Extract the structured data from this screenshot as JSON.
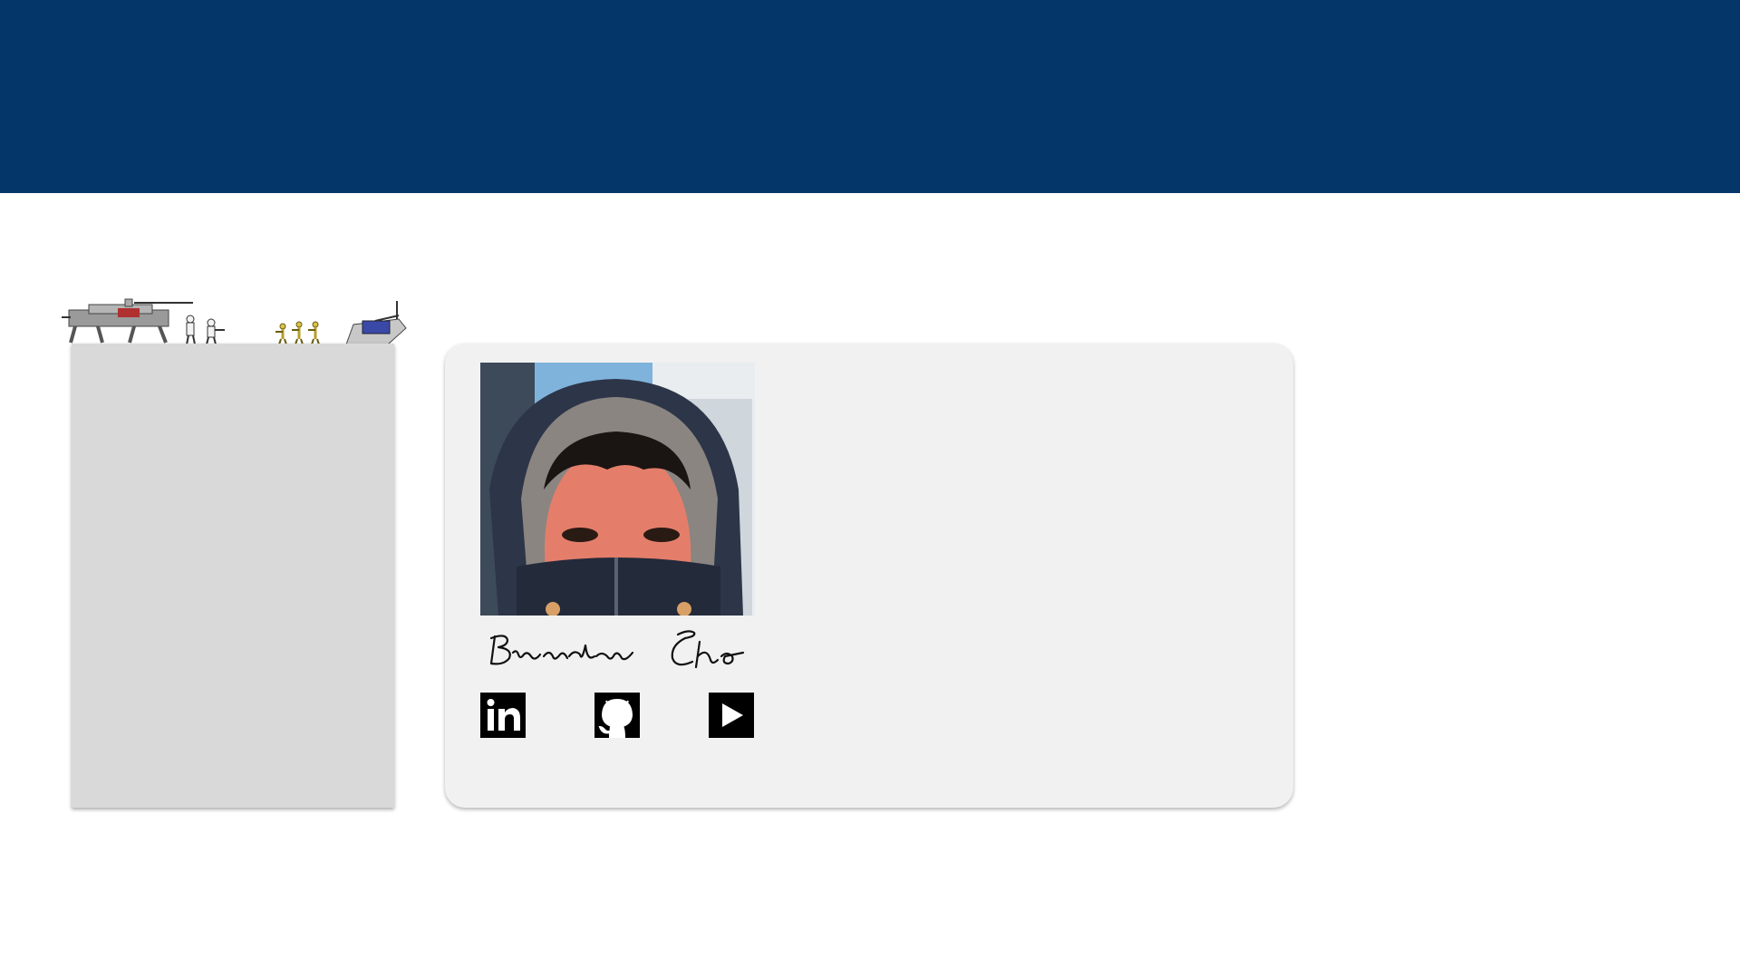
{
  "page": {
    "header_color": "#05366A",
    "background_color": "#FFFFFF",
    "panel_color": "#D9D9D9",
    "card_color": "#F1F1F1"
  },
  "scene": {
    "icons": [
      "walker-vehicle-icon",
      "trooper-icon",
      "trooper-icon",
      "droid-icon",
      "droid-icon",
      "droid-icon",
      "gunship-icon"
    ]
  },
  "profile": {
    "photo": "profile-photo",
    "signature": "Brandon Cho"
  },
  "social": {
    "icons": [
      "linkedin-icon",
      "github-icon",
      "youtube-icon"
    ],
    "icon_color": "#000000"
  }
}
